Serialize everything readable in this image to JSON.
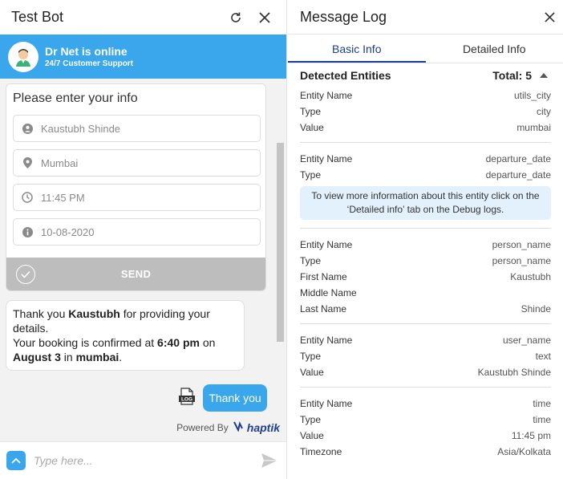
{
  "chat": {
    "title": "Test Bot",
    "agent_name": "Dr Net is online",
    "agent_sub": "24/7 Customer Support",
    "form": {
      "title": "Please enter your info",
      "fields": [
        {
          "value": "Kaustubh Shinde",
          "icon": "person-icon"
        },
        {
          "value": "Mumbai",
          "icon": "location-pin-icon"
        },
        {
          "value": "11:45 PM",
          "icon": "clock-icon"
        },
        {
          "value": "10-08-2020",
          "icon": "info-icon"
        }
      ],
      "send_label": "SEND"
    },
    "bot_message": {
      "p1": "Thank you ",
      "name": "Kaustubh",
      "p2": " for providing your details.",
      "p3": "Your booking is confirmed at ",
      "time": "6:40 pm",
      "p4": " on ",
      "date": "August 3",
      "p5": " in ",
      "city": "mumbai",
      "p6": "."
    },
    "log_icon_label": "LOG",
    "user_message": "Thank you",
    "powered_by": "Powered By",
    "brand": "haptik",
    "input_placeholder": "Type here..."
  },
  "log": {
    "title": "Message Log",
    "tabs": [
      "Basic Info",
      "Detailed Info"
    ],
    "detected_label": "Detected Entities",
    "total_label": "Total: 5",
    "entities": [
      {
        "rows": [
          [
            "Entity Name",
            "utils_city"
          ],
          [
            "Type",
            "city"
          ],
          [
            "Value",
            "mumbai"
          ]
        ]
      },
      {
        "rows": [
          [
            "Entity Name",
            "departure_date"
          ],
          [
            "Type",
            "departure_date"
          ]
        ],
        "note": "To view more information about this entity click on the ‘Detailed info’ tab on the Debug logs."
      },
      {
        "rows": [
          [
            "Entity Name",
            "person_name"
          ],
          [
            "Type",
            "person_name"
          ],
          [
            "First Name",
            "Kaustubh"
          ],
          [
            "Middle Name",
            ""
          ],
          [
            "Last Name",
            "Shinde"
          ]
        ]
      },
      {
        "rows": [
          [
            "Entity Name",
            "user_name"
          ],
          [
            "Type",
            "text"
          ],
          [
            "Value",
            "Kaustubh Shinde"
          ]
        ]
      },
      {
        "rows": [
          [
            "Entity Name",
            "time"
          ],
          [
            "Type",
            "time"
          ],
          [
            "Value",
            "11:45 pm"
          ],
          [
            "Timezone",
            "Asia/Kolkata"
          ]
        ]
      }
    ]
  },
  "colors": {
    "accent": "#3aa7ec",
    "brand": "#1d3f91",
    "send_disabled": "#bdbdbd",
    "note_bg": "#e3f1fc"
  }
}
